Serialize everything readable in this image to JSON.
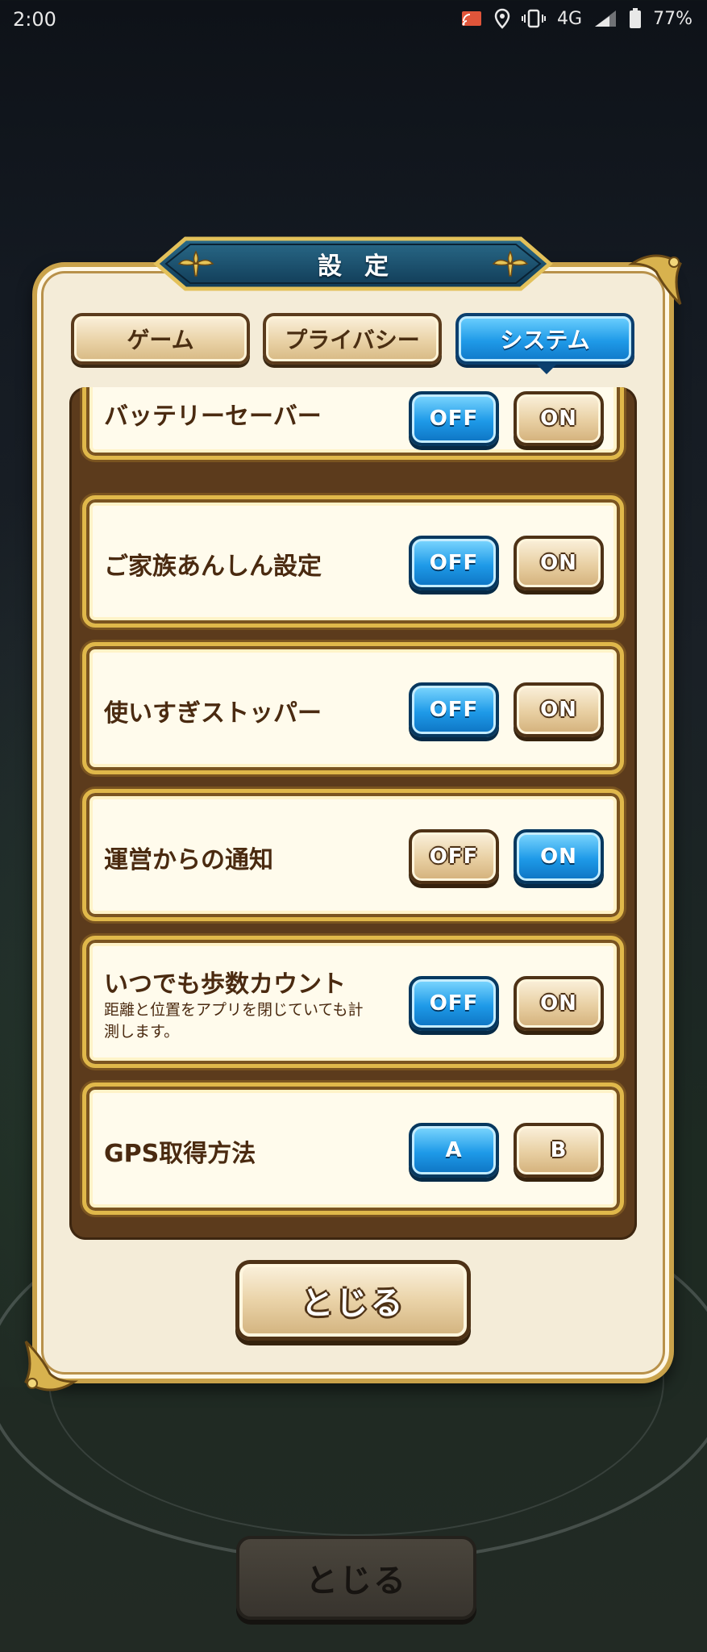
{
  "status_bar": {
    "time": "2:00",
    "network": "4G",
    "battery": "77%",
    "icons": [
      "cast-icon",
      "location-icon",
      "vibrate-icon",
      "signal-icon",
      "battery-icon"
    ]
  },
  "dialog": {
    "title": "設定",
    "tabs": [
      {
        "label": "ゲーム",
        "active": false
      },
      {
        "label": "プライバシー",
        "active": false
      },
      {
        "label": "システム",
        "active": true
      }
    ],
    "settings": [
      {
        "label": "バッテリーセーバー",
        "options": [
          "OFF",
          "ON"
        ],
        "selected": "OFF"
      },
      {
        "label": "ご家族あんしん設定",
        "options": [
          "OFF",
          "ON"
        ],
        "selected": "OFF"
      },
      {
        "label": "使いすぎストッパー",
        "options": [
          "OFF",
          "ON"
        ],
        "selected": "OFF"
      },
      {
        "label": "運営からの通知",
        "options": [
          "OFF",
          "ON"
        ],
        "selected": "ON"
      },
      {
        "label": "いつでも歩数カウント",
        "sublabel": "距離と位置をアプリを閉じていても計測します。",
        "options": [
          "OFF",
          "ON"
        ],
        "selected": "OFF"
      },
      {
        "label": "GPS取得方法",
        "options": [
          "A",
          "B"
        ],
        "selected": "A"
      }
    ],
    "close_label": "とじる"
  },
  "background": {
    "close_label": "とじる"
  },
  "colors": {
    "selected_blue": "#1f9ae8",
    "unselected_beige": "#e8cfa2",
    "frame_gold": "#c9a24a",
    "panel_brown": "#5c3b1c",
    "text_brown": "#4a2a10"
  }
}
